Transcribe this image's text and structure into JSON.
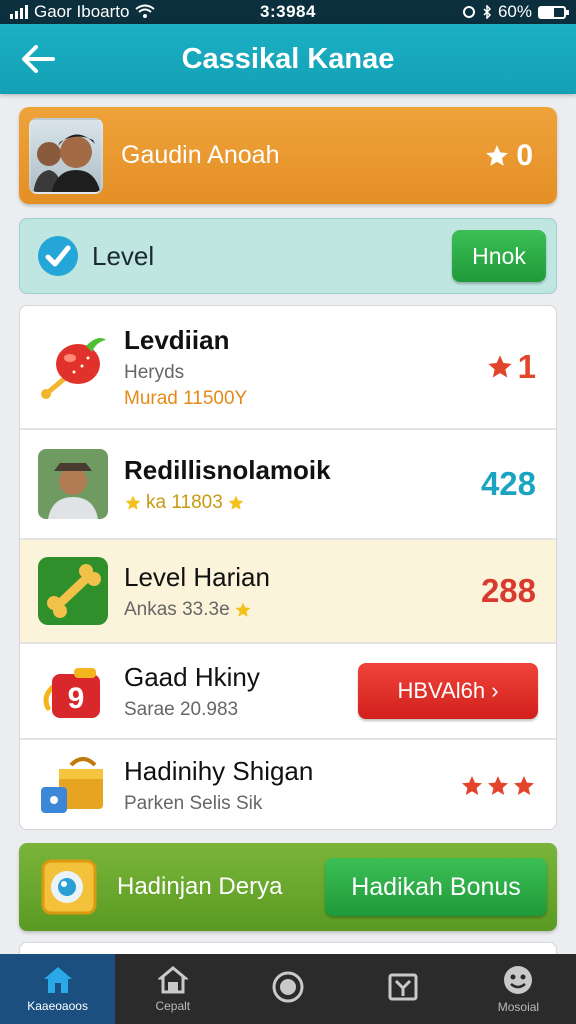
{
  "status_bar": {
    "carrier": "Gaor Iboarto",
    "time": "3:3984",
    "battery": "60%",
    "battery_level": 0.6
  },
  "header": {
    "title": "Cassikal Kanae",
    "back_icon": "arrow-left-icon"
  },
  "profile": {
    "name": "Gaudin Anoah",
    "stars": "0",
    "star_icon": "star-icon"
  },
  "level_bar": {
    "label": "Level",
    "button": "Hnok",
    "icon": "check-circle-icon"
  },
  "list": [
    {
      "icon": "tomato-rattle-icon",
      "title": "Levdiian",
      "subtitle": "Heryds",
      "detail": "Murad 11500Y",
      "right": "1",
      "right_type": "star",
      "right_color": "#e2452b"
    },
    {
      "icon": "avatar",
      "title": "Redillisnolamoik",
      "detail": "ka 11803",
      "right": "428",
      "right_color": "#1ba4c1"
    },
    {
      "icon": "bone-icon",
      "title": "Level Harian",
      "detail": "Ankas 33.3e",
      "right": "288",
      "right_color": "#d93a2f"
    },
    {
      "icon": "gift-badge-icon",
      "title": "Gaad Hkiny",
      "detail": "Sarae 20.983",
      "button": "HBVAl6h ›"
    },
    {
      "icon": "treasure-box-icon",
      "title": "Hadinihy Shigan",
      "detail": "Parken Selis Sik",
      "right_rating": 3
    }
  ],
  "bonus": {
    "title": "Hadinjan Derya",
    "button": "Hadikah Bonus",
    "icon": "badge-icon"
  },
  "nav": [
    {
      "label": "Kaaeoaoos",
      "icon": "home-icon",
      "active": true
    },
    {
      "label": "Cepalt",
      "icon": "shop-icon",
      "active": false
    },
    {
      "label": "",
      "icon": "circle-icon",
      "active": false
    },
    {
      "label": "",
      "icon": "box-icon",
      "active": false
    },
    {
      "label": "Mosoial",
      "icon": "face-icon",
      "active": false
    }
  ],
  "colors": {
    "header": "#13a0b5",
    "profile": "#e8972d",
    "level_bar": "#bfe6e1",
    "green": "#2aa546",
    "red": "#e23428",
    "nav_active": "#1a4f80"
  }
}
